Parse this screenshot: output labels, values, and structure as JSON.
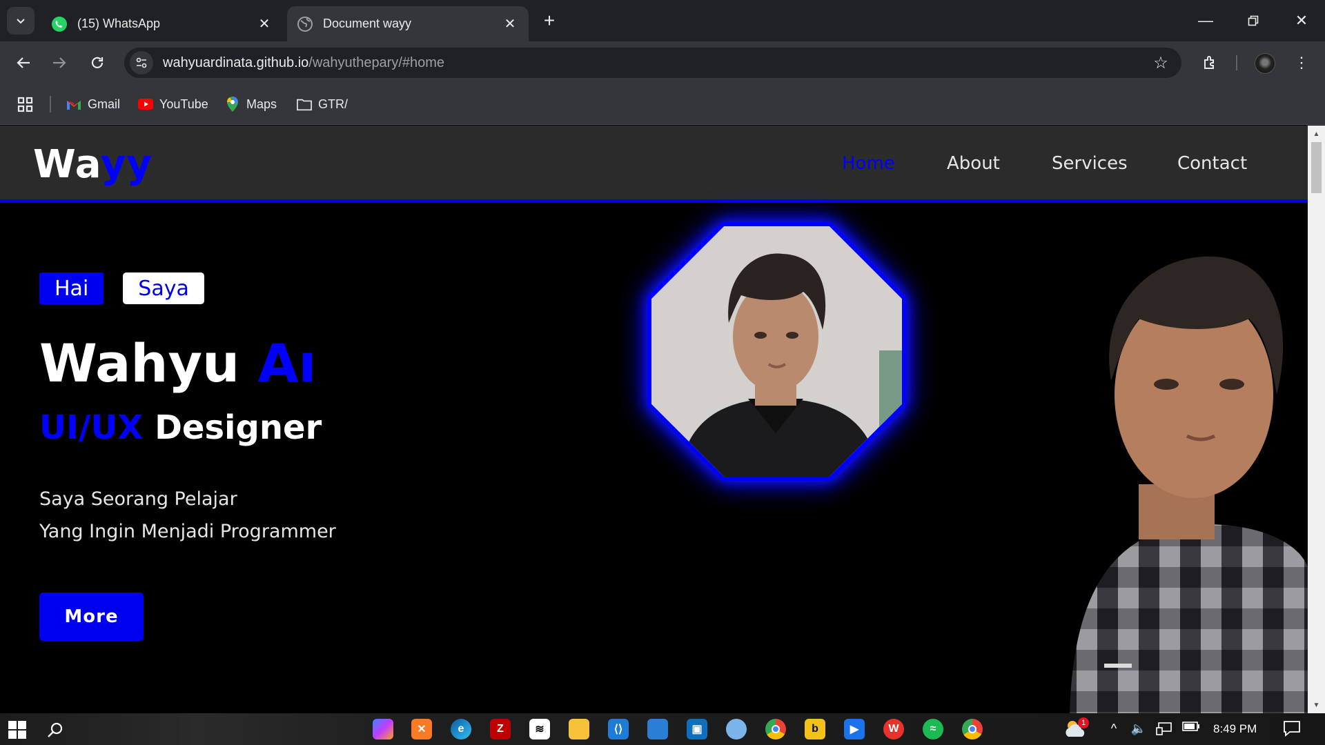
{
  "browser": {
    "tabs": [
      {
        "title": "(15) WhatsApp",
        "icon": "whatsapp-icon",
        "active": false
      },
      {
        "title": "Document wayy",
        "icon": "globe-icon",
        "active": true
      }
    ],
    "url_host": "wahyuardinata.github.io",
    "url_path": "/wahyuthepary/#home",
    "bookmarks": [
      {
        "label": "Gmail",
        "icon": "gmail-icon"
      },
      {
        "label": "YouTube",
        "icon": "youtube-icon"
      },
      {
        "label": "Maps",
        "icon": "maps-icon"
      },
      {
        "label": "GTR/",
        "icon": "folder-icon"
      }
    ]
  },
  "site": {
    "logo_main": "Wa",
    "logo_accent": "yy",
    "nav": [
      "Home",
      "About",
      "Services",
      "Contact"
    ],
    "active_nav": "Home",
    "tags": [
      "Hai",
      "Saya"
    ],
    "name_main": "Wahyu ",
    "name_accent": "Ar",
    "role_accent": "UI/UX",
    "role_main": " Designer",
    "intro_lines": [
      "Saya Seorang Pelajar",
      "Yang Ingin Menjadi Programmer"
    ],
    "cta": "More",
    "colors": {
      "accent": "#0000ff",
      "header_bg": "#2b2b2b",
      "page_bg": "#000000"
    }
  },
  "taskbar": {
    "apps": [
      "copilot-icon",
      "xampp-icon",
      "edge-icon",
      "filezilla-icon",
      "capcut-icon",
      "file-explorer-icon",
      "vscode-icon",
      "photos-icon",
      "store-icon",
      "paint-icon",
      "chrome-icon",
      "bandicam-icon",
      "media-player-icon",
      "wps-icon",
      "spotify-icon",
      "chrome-profile-icon"
    ],
    "weather_badge": "1",
    "time": "8:49 PM"
  }
}
